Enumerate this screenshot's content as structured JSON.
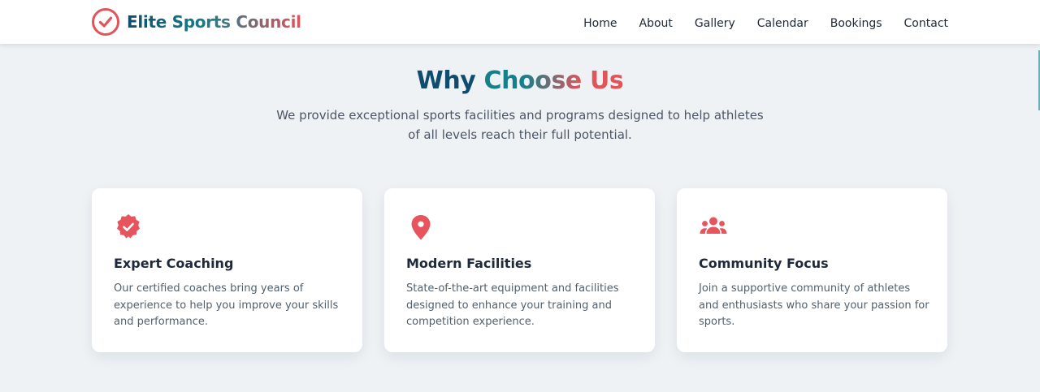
{
  "brand": {
    "name": "Elite Sports Council",
    "icon": "check-circle-icon"
  },
  "nav": {
    "items": [
      {
        "label": "Home"
      },
      {
        "label": "About"
      },
      {
        "label": "Gallery"
      },
      {
        "label": "Calendar"
      },
      {
        "label": "Bookings"
      },
      {
        "label": "Contact"
      }
    ]
  },
  "section": {
    "title_part1": "Why",
    "title_part2": "Choose",
    "title_part3": "Us",
    "subtitle": "We provide exceptional sports facilities and programs designed to help athletes of all levels reach their full potential."
  },
  "features": [
    {
      "icon": "badge-check-icon",
      "title": "Expert Coaching",
      "text": "Our certified coaches bring years of experience to help you improve your skills and performance."
    },
    {
      "icon": "map-pin-icon",
      "title": "Modern Facilities",
      "text": "State-of-the-art equipment and facilities designed to enhance your training and competition experience."
    },
    {
      "icon": "users-icon",
      "title": "Community Focus",
      "text": "Join a supportive community of athletes and enthusiasts who share your passion for sports."
    }
  ],
  "colors": {
    "primary": "#0f4c6e",
    "teal": "#15808a",
    "accent": "#e0545a",
    "background": "#eef2f5"
  }
}
